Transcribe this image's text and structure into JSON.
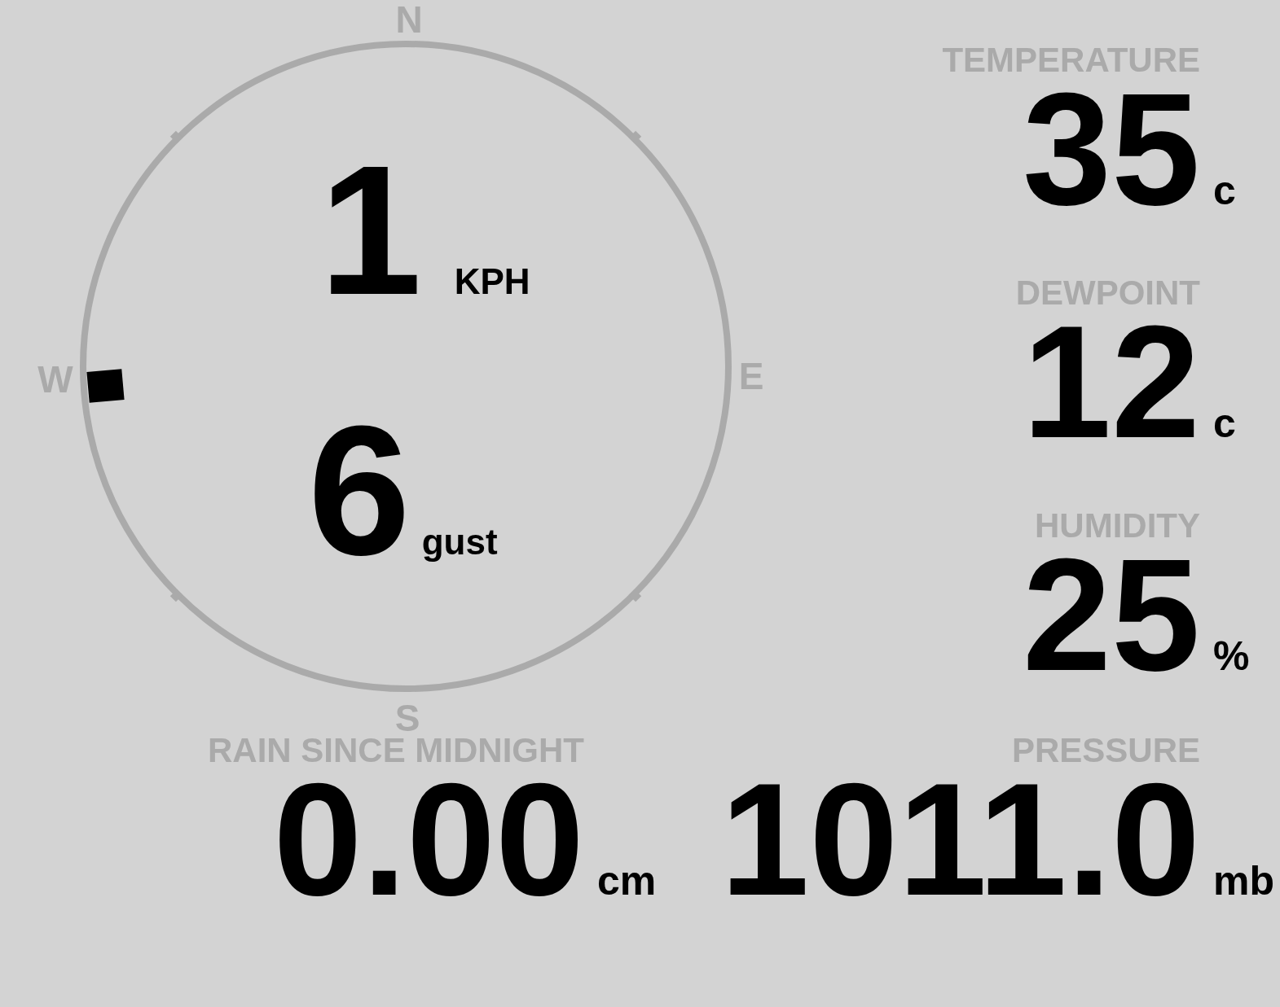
{
  "compass": {
    "north": "N",
    "east": "E",
    "south": "S",
    "west": "W"
  },
  "wind": {
    "speed": "1",
    "speed_unit": "KPH",
    "gust": "6",
    "gust_unit": "gust"
  },
  "readings": [
    {
      "label": "TEMPERATURE",
      "value": "35",
      "unit": "c"
    },
    {
      "label": "DEWPOINT",
      "value": "12",
      "unit": "c"
    },
    {
      "label": "HUMIDITY",
      "value": "25",
      "unit": "%"
    }
  ],
  "bottom_readings": [
    {
      "label": "RAIN SINCE MIDNIGHT",
      "value": "0.00",
      "unit": "cm"
    },
    {
      "label": "PRESSURE",
      "value": "1011.0",
      "unit": "mb"
    }
  ]
}
